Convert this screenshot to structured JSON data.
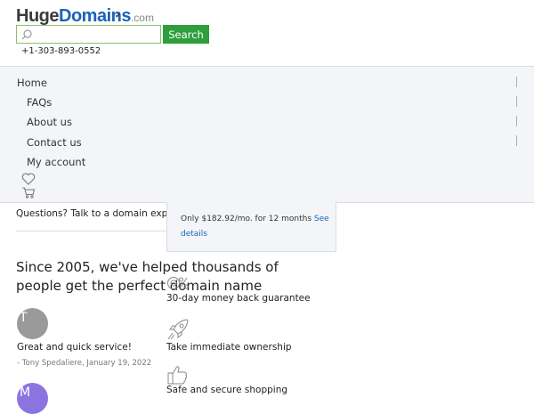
{
  "header": {
    "logo": {
      "part1": "Huge",
      "part2": "Domains",
      "part3": ".com"
    },
    "search": {
      "placeholder": "",
      "button_label": "Search"
    },
    "phone": "+1-303-893-0552"
  },
  "nav": {
    "items": [
      {
        "label": "Home"
      },
      {
        "label": "FAQs"
      },
      {
        "label": "About us"
      },
      {
        "label": "Contact us"
      },
      {
        "label": "My account"
      }
    ],
    "icons": [
      "heart-icon",
      "cart-icon"
    ]
  },
  "content": {
    "expert_label": "Questions? Talk to a domain expert:",
    "price": {
      "text": "Only $182.92/mo. for 12 months ",
      "link": "See details"
    },
    "headline": "Since 2005, we've helped thousands of people get the perfect domain name",
    "reviews": [
      {
        "initial": "T",
        "avatar_color": "#9a9a9a",
        "text": "Great and quick service!",
        "author_line": "- Tony Spedaliere, January 19, 2022"
      },
      {
        "initial": "M",
        "avatar_color": "#8c74e0"
      }
    ],
    "benefits": [
      {
        "icon": "percent-icon",
        "text": "30-day money back guarantee"
      },
      {
        "icon": "rocket-icon",
        "text": "Take immediate ownership"
      },
      {
        "icon": "thumbs-up-icon",
        "text": "Safe and secure shopping"
      }
    ]
  },
  "colors": {
    "brand_blue": "#1a63b8",
    "search_green": "#2f9e3d",
    "panel_bg": "#f3f5f8"
  }
}
